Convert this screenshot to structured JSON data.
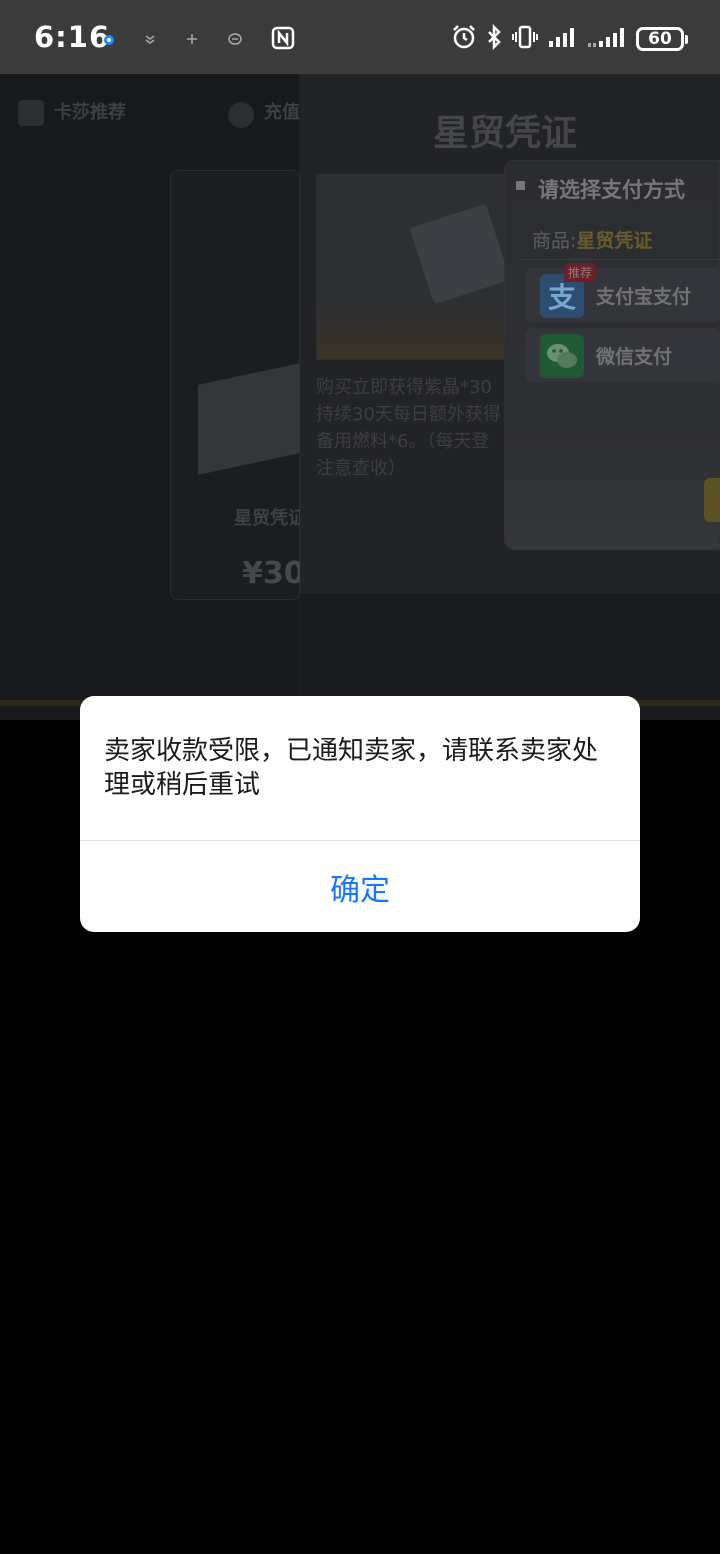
{
  "status_bar": {
    "time": "6:16",
    "battery": "60",
    "icons": [
      "app-notification-icon",
      "download-icon",
      "voice-icon",
      "message-icon",
      "nfc-icon",
      "alarm-icon",
      "bluetooth-icon",
      "vibrate-icon",
      "signal-icon",
      "signal-icon-2",
      "battery-icon"
    ]
  },
  "game": {
    "nav_items": [
      {
        "label": "卡莎推荐"
      },
      {
        "label": "充值"
      }
    ],
    "left_product_name": "星贸凭证",
    "left_price": "¥30",
    "center_title": "星贸凭证",
    "product_description": "购买立即获得紫晶*30\n持续30天每日额外获得\n备用燃料*6。（每天登\n注意查收）",
    "pay_panel": {
      "title": "请选择支付方式",
      "goods_label": "商品:",
      "goods_name": "星贸凭证",
      "options": [
        {
          "label": "支付宝支付",
          "badge": "推荐",
          "icon": "alipay-icon",
          "color": "#1677ff"
        },
        {
          "label": "微信支付",
          "icon": "wechat-icon",
          "color": "#07c160"
        }
      ]
    }
  },
  "dialog": {
    "message": "卖家收款受限，已通知卖家，请联系卖家处理或稍后重试",
    "confirm_label": "确定",
    "accent_color": "#1677ff"
  }
}
